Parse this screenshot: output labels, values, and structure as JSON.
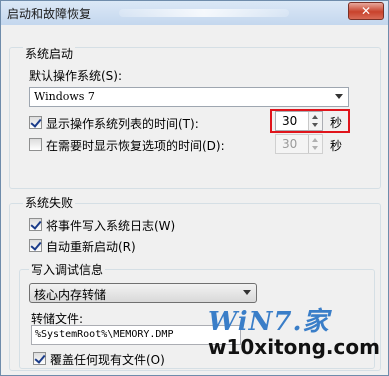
{
  "window": {
    "title": "启动和故障恢复",
    "close_label": "✕"
  },
  "system_startup": {
    "group_title": "系统启动",
    "default_os_label": "默认操作系统(S):",
    "default_os_value": "Windows 7",
    "show_os_list": {
      "label": "显示操作系统列表的时间(T):",
      "checked": true,
      "value": "30",
      "unit": "秒"
    },
    "show_recovery": {
      "label": "在需要时显示恢复选项的时间(D):",
      "checked": false,
      "value": "30",
      "unit": "秒"
    }
  },
  "system_failure": {
    "group_title": "系统失败",
    "write_event": {
      "label": "将事件写入系统日志(W)",
      "checked": true
    },
    "auto_restart": {
      "label": "自动重新启动(R)",
      "checked": true
    },
    "debug_info": {
      "group_title": "写入调试信息",
      "type_value": "核心内存转储",
      "dump_file_label": "转储文件:",
      "dump_file_value": "%SystemRoot%\\MEMORY.DMP",
      "overwrite": {
        "label": "覆盖任何现有文件(O)",
        "checked": true
      }
    }
  },
  "watermark": {
    "logo": "WiN7.家",
    "url": "w10xitong.com"
  },
  "colors": {
    "highlight": "#e0141b",
    "title_bar": "#c4d7ee",
    "dialog_bg": "#f0f0f0"
  }
}
